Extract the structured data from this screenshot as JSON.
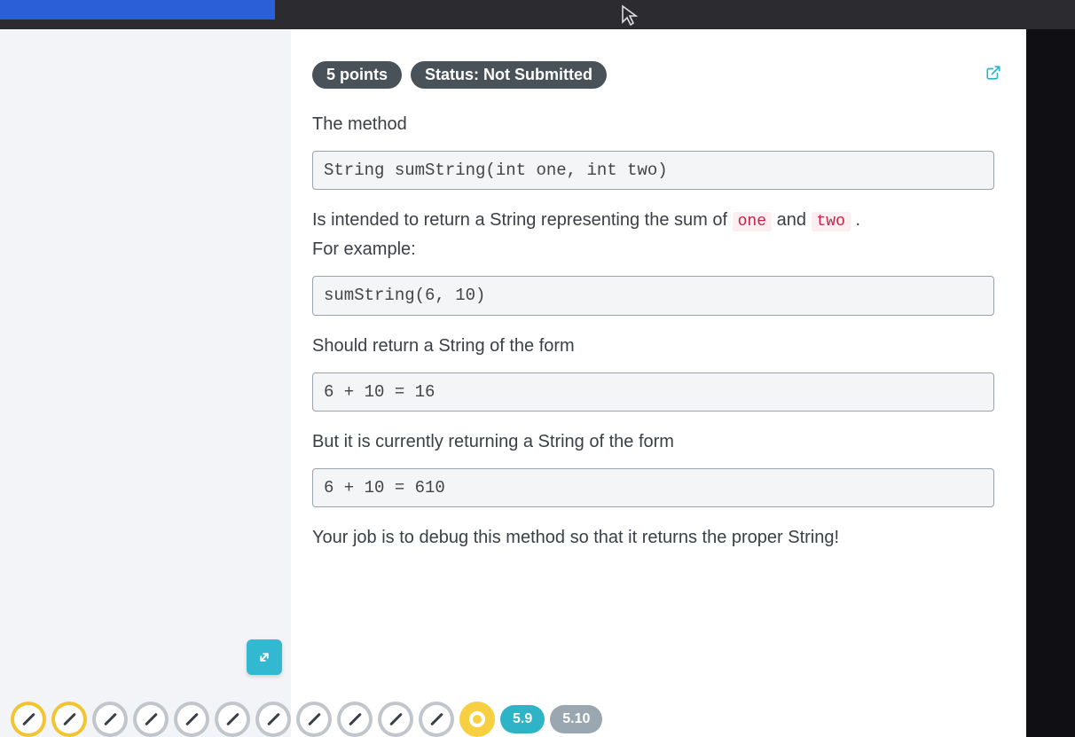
{
  "header": {
    "points": "5 points",
    "status": "Status: Not Submitted"
  },
  "problem": {
    "intro": "The method",
    "signature": "String sumString(int one, int two)",
    "intent_prefix": "Is intended to return a String representing the sum of ",
    "param1": "one",
    "intent_mid": " and ",
    "param2": "two",
    "intent_suffix": " .",
    "example_label": "For example:",
    "example_call": "sumString(6, 10)",
    "should_return": "Should return a String of the form",
    "correct_output": "6 + 10 = 16",
    "but_text": "But it is currently returning a String of the form",
    "wrong_output": "6 + 10 = 610",
    "task": "Your job is to debug this method so that it returns the proper String!"
  },
  "nav": {
    "current": "5.9",
    "next": "5.10"
  }
}
